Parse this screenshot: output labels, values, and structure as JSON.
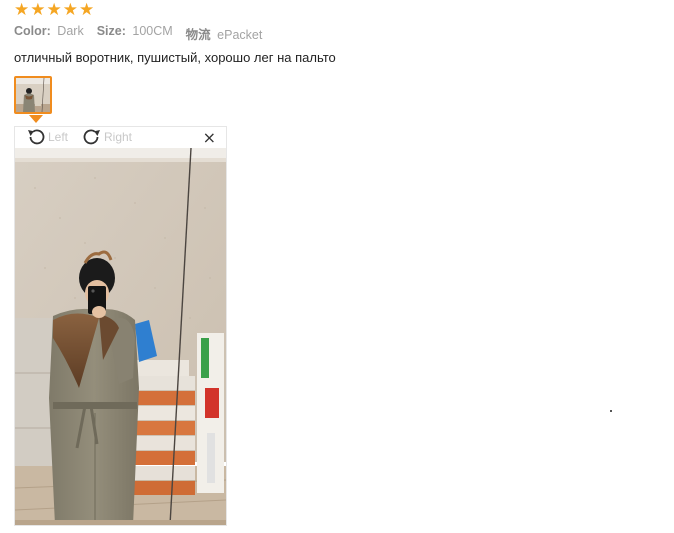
{
  "rating": {
    "stars": [
      "★",
      "★",
      "★",
      "★",
      "★"
    ],
    "value": 5,
    "color": "#f5a623"
  },
  "meta": {
    "color_label": "Color:",
    "color_value": "Dark",
    "size_label": "Size:",
    "size_value": "100CM",
    "shipping_label": "物流",
    "shipping_value": "ePacket"
  },
  "review": {
    "text": "отличный воротник, пушистый, хорошо лег на пальто"
  },
  "viewer": {
    "rotate_left_label": "Left",
    "rotate_right_label": "Right",
    "close_symbol": "×",
    "icons": [
      "rotate-left-icon",
      "rotate-right-icon",
      "close-icon"
    ]
  },
  "colors": {
    "accent": "#f08c1e",
    "star": "#f5a623"
  }
}
